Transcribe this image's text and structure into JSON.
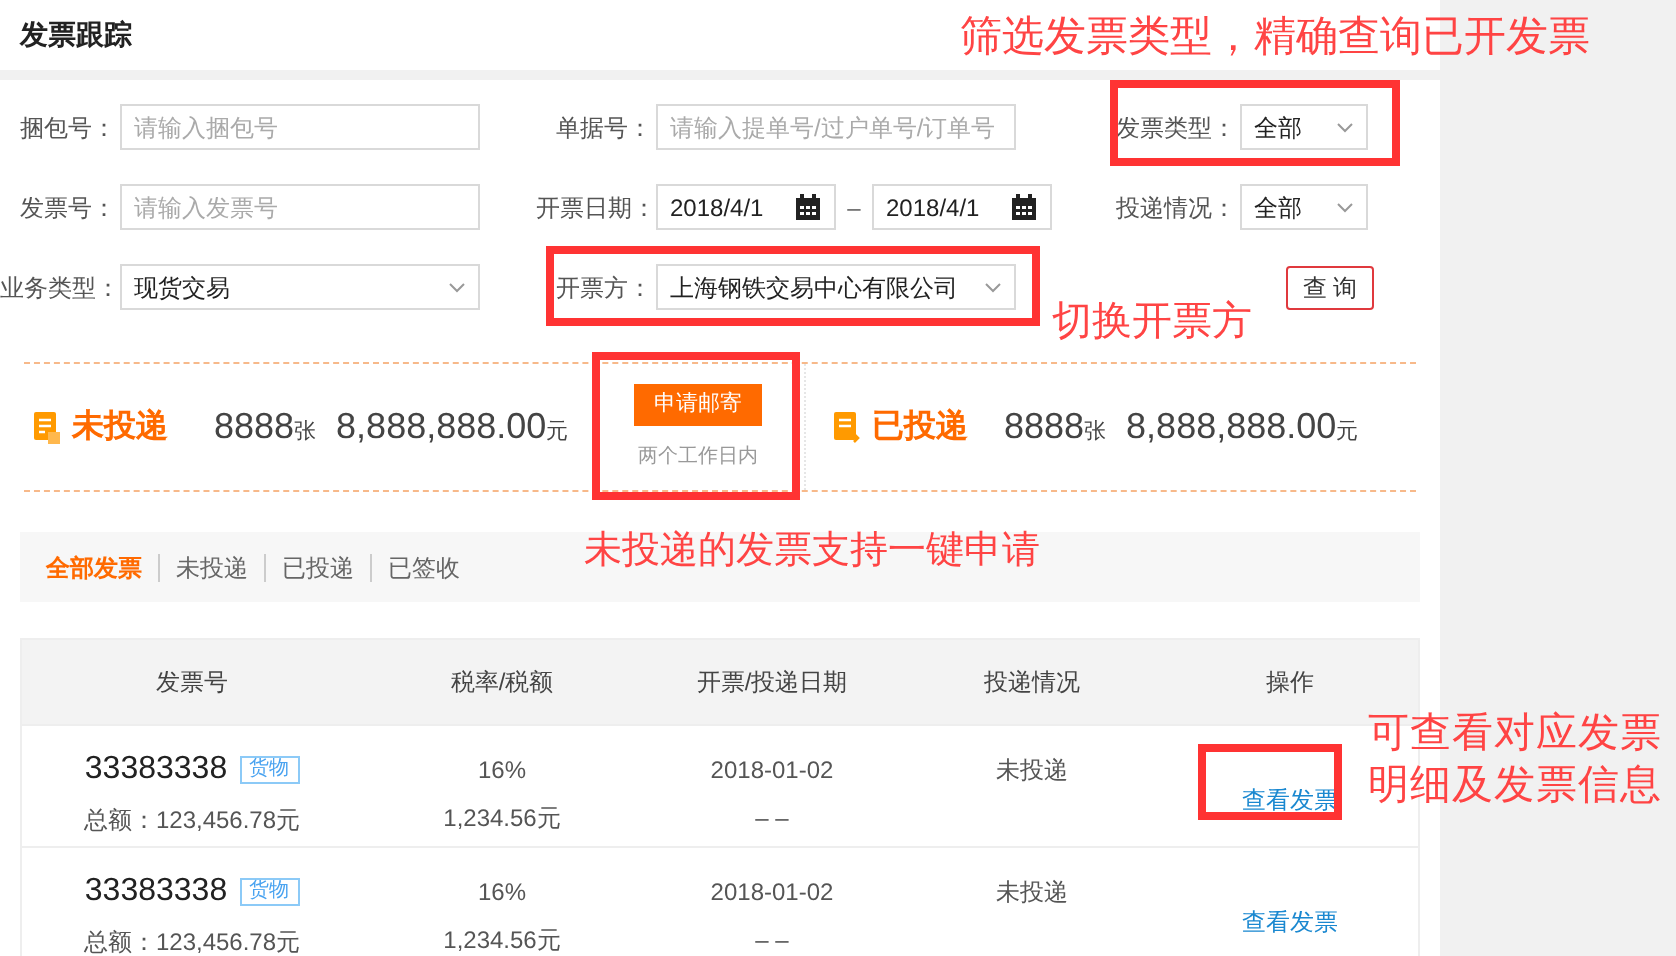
{
  "page_title": "发票跟踪",
  "filters": [
    {
      "kind": "text",
      "label": "捆包号：",
      "placeholder": "请输入捆包号"
    },
    {
      "kind": "text",
      "label": "单据号：",
      "placeholder": "请输入提单号/过户单号/订单号"
    },
    {
      "kind": "select",
      "label": "发票类型：",
      "value": "全部"
    },
    {
      "kind": "text",
      "label": "发票号：",
      "placeholder": "请输入发票号"
    },
    {
      "kind": "daterange",
      "label": "开票日期：",
      "from": "2018/4/1",
      "separator": "–",
      "to": "2018/4/1"
    },
    {
      "kind": "select",
      "label": "投递情况：",
      "value": "全部"
    },
    {
      "kind": "select",
      "label": "业务类型：",
      "value": "现货交易"
    },
    {
      "kind": "select",
      "label": "开票方：",
      "value": "上海钢铁交易中心有限公司"
    },
    {
      "kind": "button",
      "label": "查 询"
    }
  ],
  "summary": {
    "items": [
      {
        "label": "未投递",
        "count": "8888",
        "count_unit": "张",
        "amount": "8,888,888.00",
        "amount_unit": "元"
      },
      {
        "label": "已投递",
        "count": "8888",
        "count_unit": "张",
        "amount": "8,888,888.00",
        "amount_unit": "元"
      }
    ],
    "mail_button": "申请邮寄",
    "mail_note": "两个工作日内"
  },
  "tabs": [
    {
      "label": "全部发票",
      "selected": true
    },
    {
      "label": "未投递",
      "selected": false
    },
    {
      "label": "已投递",
      "selected": false
    },
    {
      "label": "已签收",
      "selected": false
    }
  ],
  "table": {
    "columns": [
      "发票号",
      "税率/税额",
      "开票/投递日期",
      "投递情况",
      "操作"
    ],
    "rows": [
      {
        "invoice_no": "33383338",
        "tag": "货物",
        "total": "总额：123,456.78元",
        "tax_rate": "16%",
        "tax_amount": "1,234.56元",
        "issue_date": "2018-01-02",
        "delivery_date": "– –",
        "status": "未投递",
        "action": "查看发票"
      },
      {
        "invoice_no": "33383338",
        "tag": "货物",
        "total": "总额：123,456.78元",
        "tax_rate": "16%",
        "tax_amount": "1,234.56元",
        "issue_date": "2018-01-02",
        "delivery_date": "– –",
        "status": "未投递",
        "action": "查看发票"
      }
    ]
  },
  "annotations": [
    "筛选发票类型，精确查询已开发票",
    "切换开票方",
    "未投递的发票支持一键申请",
    "可查看对应发票明细及发票信息"
  ]
}
